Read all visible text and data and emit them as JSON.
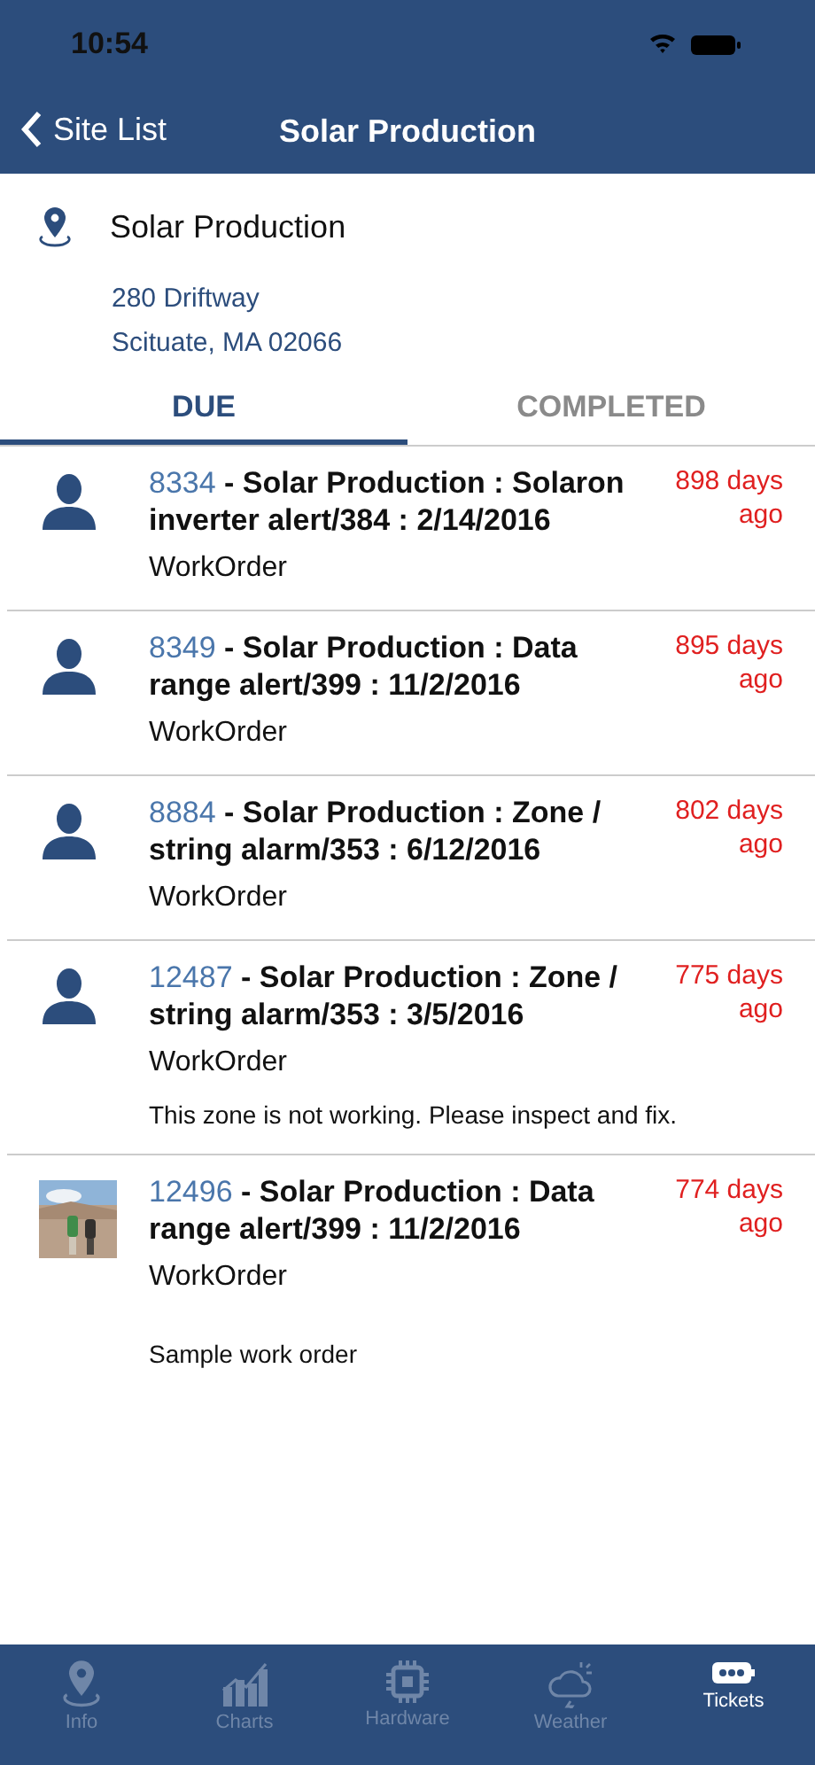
{
  "status_bar": {
    "time": "10:54"
  },
  "nav": {
    "back": "Site List",
    "title": "Solar Production"
  },
  "site": {
    "name": "Solar Production",
    "address_lines": [
      "280 Driftway",
      "Scituate, MA 02066"
    ]
  },
  "tabs": [
    {
      "label": "DUE",
      "selected": true
    },
    {
      "label": "COMPLETED",
      "selected": false
    }
  ],
  "tickets": [
    {
      "kind": "person",
      "number": "8334",
      "title": " - Solar Production : Solaron inverter alert/384 : 2/14/2016",
      "age": "898 days ago",
      "type": "WorkOrder"
    },
    {
      "kind": "person",
      "number": "8349",
      "title": " - Solar Production : Data range alert/399 : 11/2/2016",
      "age": "895 days ago",
      "type": "WorkOrder"
    },
    {
      "kind": "person",
      "number": "8884",
      "title": " - Solar Production : Zone / string alarm/353 : 6/12/2016",
      "age": "802 days ago",
      "type": "WorkOrder"
    },
    {
      "kind": "person",
      "number": "12487",
      "title": " - Solar Production : Zone / string alarm/353 : 3/5/2016",
      "age": "775 days ago",
      "type": "WorkOrder",
      "note": "This zone is not working. Please inspect and fix."
    },
    {
      "kind": "picture",
      "number": "12496",
      "title": " - Solar Production : Data range alert/399 : 11/2/2016",
      "age": "774 days ago",
      "type": "WorkOrder",
      "note": "Sample work order"
    }
  ],
  "tab_bar": [
    {
      "kind": "pin",
      "label": "Info",
      "selected": false
    },
    {
      "kind": "chart",
      "label": "Charts",
      "selected": false
    },
    {
      "kind": "chip",
      "label": "Hardware",
      "selected": false
    },
    {
      "kind": "weather",
      "label": "Weather",
      "selected": false
    },
    {
      "kind": "ticket",
      "label": "Tickets",
      "selected": true
    }
  ]
}
